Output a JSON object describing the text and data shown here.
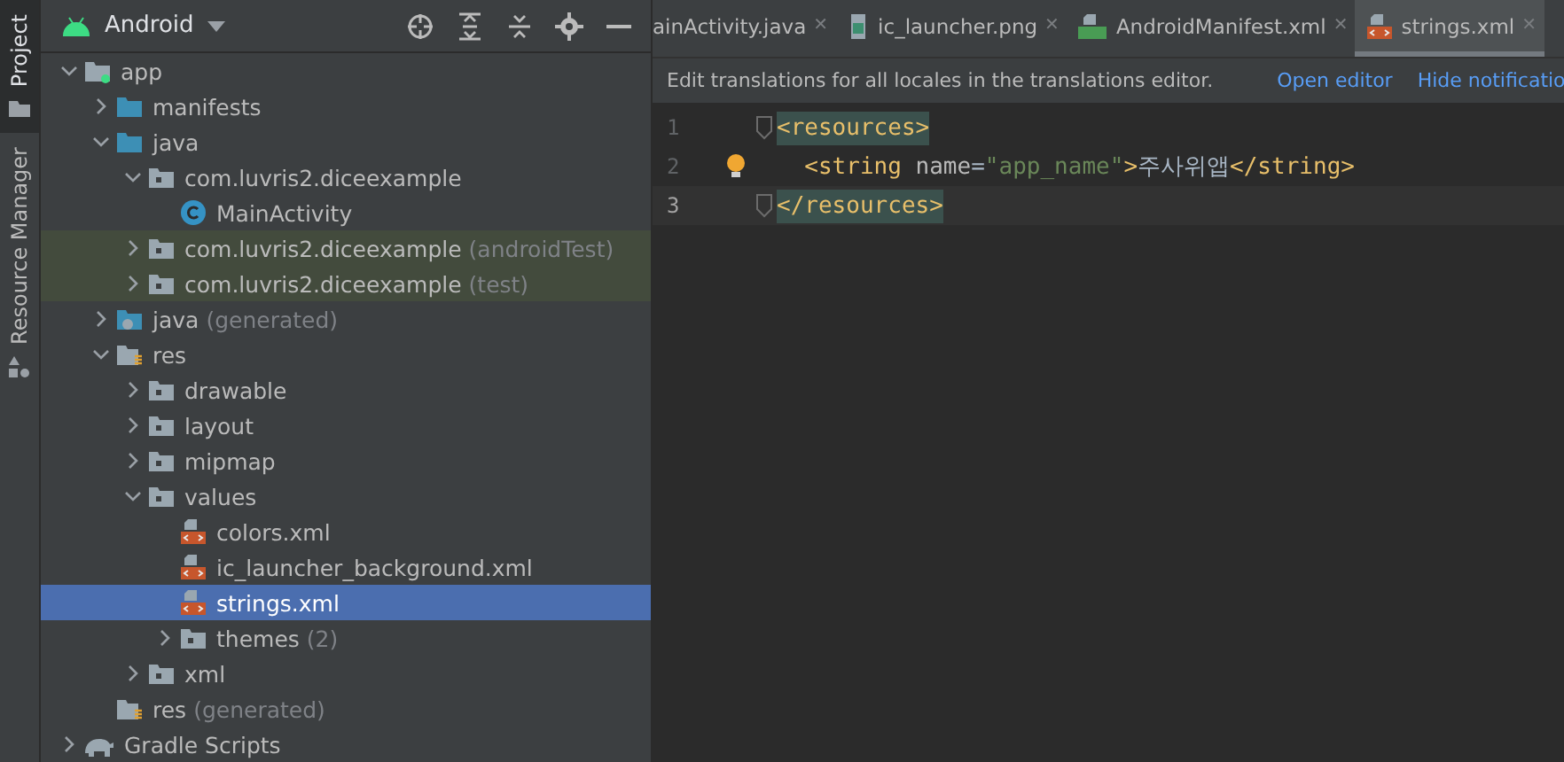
{
  "side_tabs": [
    {
      "label": "Project",
      "selected": true,
      "kind": "project"
    },
    {
      "label": "Resource Manager",
      "selected": false,
      "kind": "resources"
    }
  ],
  "project_panel": {
    "view": "Android",
    "tree": [
      {
        "label": "app",
        "kind": "module",
        "expanded": true,
        "children": [
          {
            "label": "manifests",
            "kind": "source",
            "expanded": false
          },
          {
            "label": "java",
            "kind": "source",
            "expanded": true,
            "children": [
              {
                "label": "com.luvris2.diceexample",
                "kind": "package",
                "expanded": true,
                "children": [
                  {
                    "label": "MainActivity",
                    "kind": "class"
                  }
                ]
              },
              {
                "label": "com.luvris2.diceexample",
                "note": "(androidTest)",
                "kind": "package",
                "expanded": false,
                "highlighted": true
              },
              {
                "label": "com.luvris2.diceexample",
                "note": "(test)",
                "kind": "package",
                "expanded": false,
                "highlighted": true
              }
            ]
          },
          {
            "label": "java",
            "note": "(generated)",
            "kind": "generated",
            "expanded": false
          },
          {
            "label": "res",
            "kind": "res",
            "expanded": true,
            "children": [
              {
                "label": "drawable",
                "kind": "package",
                "expanded": false
              },
              {
                "label": "layout",
                "kind": "package",
                "expanded": false
              },
              {
                "label": "mipmap",
                "kind": "package",
                "expanded": false
              },
              {
                "label": "values",
                "kind": "package",
                "expanded": true,
                "children": [
                  {
                    "label": "colors.xml",
                    "kind": "xml",
                    "selected": false
                  },
                  {
                    "label": "ic_launcher_background.xml",
                    "kind": "xml",
                    "selected": false
                  },
                  {
                    "label": "strings.xml",
                    "kind": "xml",
                    "selected": true
                  },
                  {
                    "label": "themes",
                    "note": "(2)",
                    "kind": "package",
                    "expanded": false
                  }
                ]
              },
              {
                "label": "xml",
                "kind": "package",
                "expanded": false
              }
            ]
          },
          {
            "label": "res",
            "note": "(generated)",
            "kind": "res"
          }
        ]
      },
      {
        "label": "Gradle Scripts",
        "kind": "gradle",
        "expanded": false
      }
    ]
  },
  "tabs": [
    {
      "label": "ainActivity.java",
      "close": "✕",
      "kind": "none",
      "selected": false
    },
    {
      "label": "ic_launcher.png",
      "close": "✕",
      "kind": "image",
      "selected": false
    },
    {
      "label": "AndroidManifest.xml",
      "close": "✕",
      "kind": "manifest",
      "selected": false
    },
    {
      "label": "strings.xml",
      "close": "✕",
      "kind": "xml",
      "selected": true
    }
  ],
  "notification": {
    "message": "Edit translations for all locales in the translations editor.",
    "links": [
      "Open editor",
      "Hide notificatio"
    ]
  },
  "editor": {
    "lines": [
      {
        "number": "1",
        "current": false,
        "fold": true,
        "bulb": false,
        "matched": true,
        "tokens": [
          {
            "kind": "tag",
            "text": "<resources>"
          }
        ]
      },
      {
        "number": "2",
        "current": false,
        "fold": false,
        "bulb": true,
        "matched": false,
        "tokens": [
          {
            "kind": "tag",
            "text": "  <string "
          },
          {
            "kind": "attr",
            "text": "name"
          },
          {
            "kind": "plain",
            "text": "="
          },
          {
            "kind": "value",
            "text": "\"app_name\""
          },
          {
            "kind": "tag",
            "text": ">"
          },
          {
            "kind": "plain",
            "text": "주사위앱"
          },
          {
            "kind": "tag",
            "text": "</string>"
          }
        ]
      },
      {
        "number": "3",
        "current": true,
        "fold": true,
        "bulb": false,
        "matched": true,
        "tokens": [
          {
            "kind": "tag",
            "text": "</resources>"
          }
        ]
      }
    ]
  }
}
